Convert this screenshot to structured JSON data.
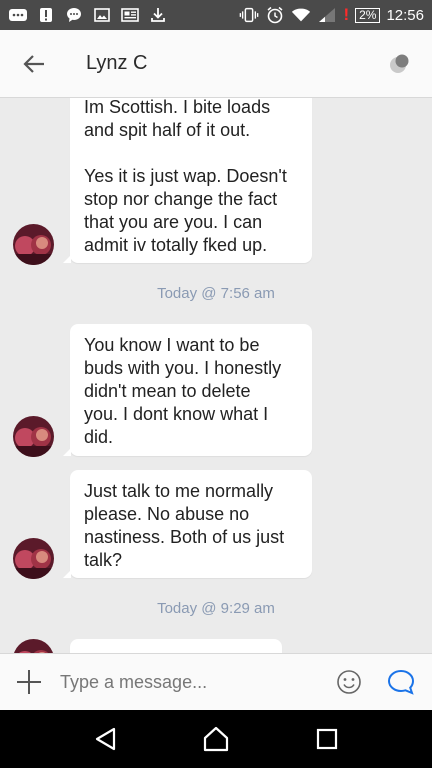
{
  "status_bar": {
    "battery": "2%",
    "time": "12:56"
  },
  "header": {
    "contact_name": "Lynz C"
  },
  "messages": [
    {
      "lines": [
        "Im Scottish.  I bite loads",
        "and spit half of it out."
      ],
      "lines2": [
        "Yes it is just wap. Doesn't",
        "stop nor change the fact",
        "that you are you. I can",
        "admit iv totally fked up."
      ]
    },
    {
      "lines": [
        "You know I want to be",
        "buds with you. I honestly",
        "didn't mean to delete",
        "you. I dont know what I",
        "did."
      ]
    },
    {
      "lines": [
        "Just talk to me normally",
        "please. No abuse no",
        "nastiness. Both of us just",
        "talk?"
      ]
    }
  ],
  "timestamps": [
    "Today @ 7:56 am",
    "Today @ 9:29 am"
  ],
  "composer": {
    "placeholder": "Type a message..."
  },
  "colors": {
    "status_bar": "#4a4a4a",
    "accent": "#1a73e8",
    "timestamp": "#8a9ab3",
    "background": "#ebebeb"
  },
  "icons": {
    "back": "arrow-left-icon",
    "status": "presence-icon",
    "add": "plus-icon",
    "emoji": "smiley-icon",
    "send": "chat-bubble-icon"
  }
}
